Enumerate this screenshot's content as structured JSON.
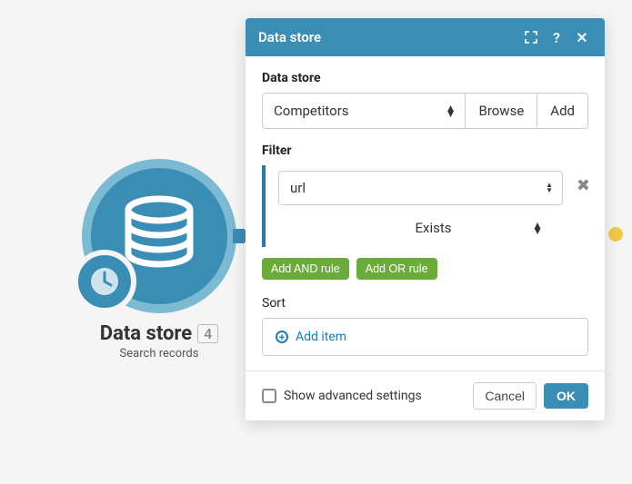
{
  "node": {
    "title": "Data store",
    "badge": "4",
    "subtitle": "Search records"
  },
  "dialog": {
    "title": "Data store",
    "datastore_label": "Data store",
    "datastore_value": "Competitors",
    "browse": "Browse",
    "add": "Add",
    "filter_label": "Filter",
    "filter_field": "url",
    "filter_condition": "Exists",
    "add_and": "Add AND rule",
    "add_or": "Add OR rule",
    "sort_label": "Sort",
    "add_item": "Add item",
    "advanced": "Show advanced settings",
    "cancel": "Cancel",
    "ok": "OK"
  }
}
